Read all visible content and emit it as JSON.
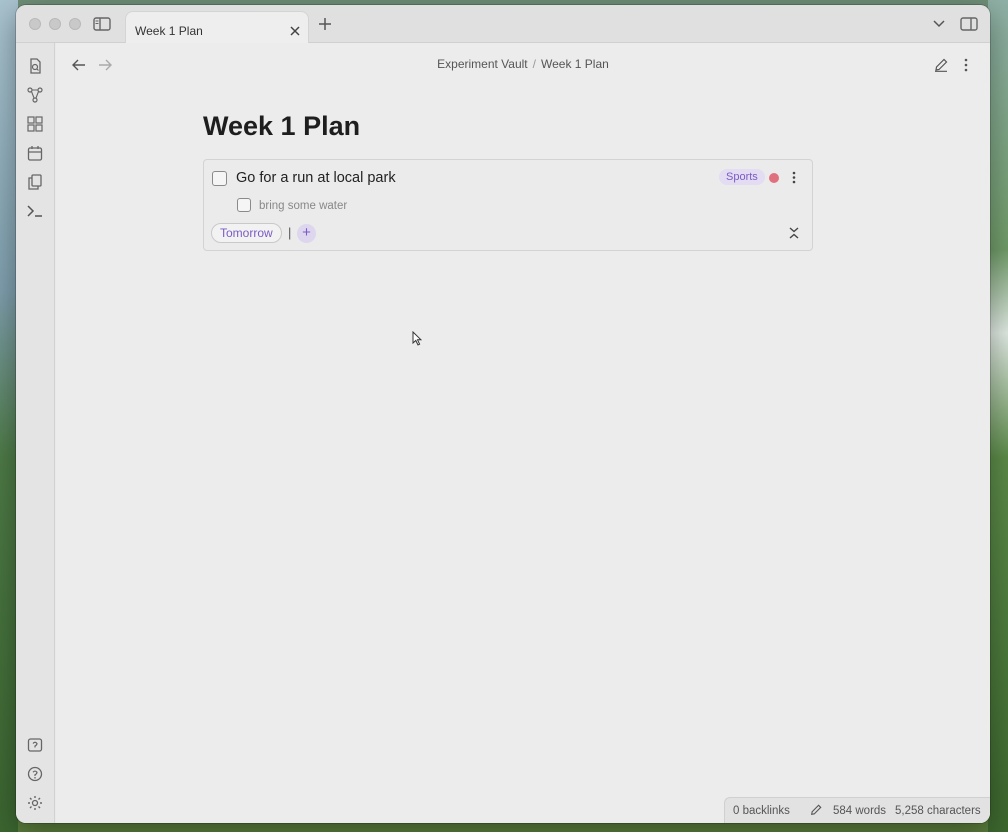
{
  "tab": {
    "title": "Week 1 Plan"
  },
  "breadcrumb": {
    "vault": "Experiment Vault",
    "separator": "/",
    "note": "Week 1 Plan"
  },
  "note": {
    "title": "Week 1 Plan"
  },
  "task": {
    "text": "Go for a run at local park",
    "tag": "Sports",
    "priority_color": "#e0707e",
    "subtask": "bring some water",
    "date": "Tomorrow",
    "separator": "|",
    "add_label": "+"
  },
  "status": {
    "backlinks": "0 backlinks",
    "words": "584 words",
    "characters": "5,258 characters"
  },
  "colors": {
    "accent": "#7a5bc4",
    "tag_bg": "#e3dcf2"
  }
}
